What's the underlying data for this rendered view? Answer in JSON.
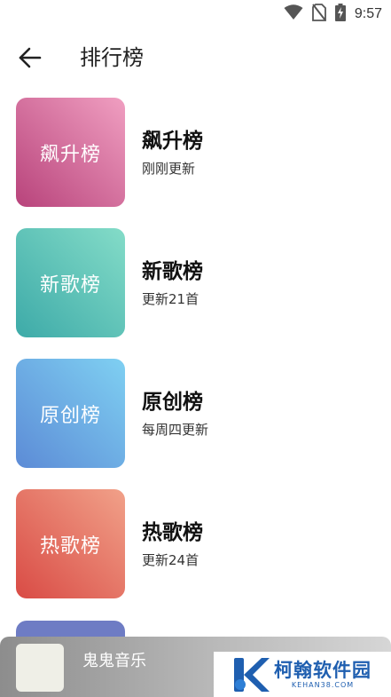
{
  "status_bar": {
    "time": "9:57",
    "icons": [
      "wifi-icon",
      "no-sim-icon",
      "battery-charging-icon"
    ]
  },
  "app_bar": {
    "back_icon": "arrow-left-icon",
    "title": "排行榜"
  },
  "charts": [
    {
      "cover_label": "飙升榜",
      "title": "飙升榜",
      "subtitle": "刚刚更新",
      "gradient": [
        "#f09fc1",
        "#b8437b"
      ]
    },
    {
      "cover_label": "新歌榜",
      "title": "新歌榜",
      "subtitle": "更新21首",
      "gradient": [
        "#84dcc8",
        "#3daaa8"
      ]
    },
    {
      "cover_label": "原创榜",
      "title": "原创榜",
      "subtitle": "每周四更新",
      "gradient": [
        "#7fd0f2",
        "#5c8bd6"
      ]
    },
    {
      "cover_label": "热歌榜",
      "title": "热歌榜",
      "subtitle": "更新24首",
      "gradient": [
        "#f1a189",
        "#d94b45"
      ]
    }
  ],
  "player": {
    "song_title": "鬼鬼音乐"
  },
  "watermark": {
    "text": "柯翰软件园",
    "domain": "KEHAN38.COM"
  },
  "colors": {
    "partial_cover": "#6e7cc4",
    "watermark_blue": "#1f5fb0"
  }
}
